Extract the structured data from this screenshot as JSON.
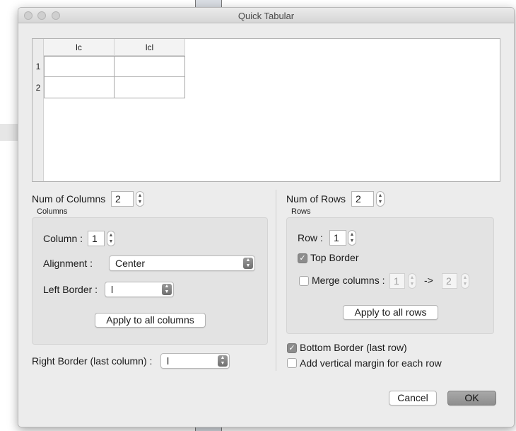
{
  "window": {
    "title": "Quick Tabular"
  },
  "table_editor": {
    "column_headers": [
      "lc",
      "lcl"
    ],
    "row_numbers": [
      "1",
      "2"
    ]
  },
  "columns": {
    "num_label": "Num of Columns",
    "num_value": "2",
    "group_label": "Columns",
    "column_label": "Column :",
    "column_value": "1",
    "alignment_label": "Alignment :",
    "alignment_value": "Center",
    "left_border_label": "Left Border :",
    "left_border_value": "l",
    "apply_button": "Apply to all columns",
    "right_border_label": "Right Border (last column) :",
    "right_border_value": "l"
  },
  "rows": {
    "num_label": "Num of Rows",
    "num_value": "2",
    "group_label": "Rows",
    "row_label": "Row :",
    "row_value": "1",
    "top_border_label": "Top Border",
    "top_border_checked": true,
    "merge_label": "Merge columns :",
    "merge_checked": false,
    "merge_from": "1",
    "merge_arrow": "->",
    "merge_to": "2",
    "apply_button": "Apply to all rows",
    "bottom_border_label": "Bottom Border (last row)",
    "bottom_border_checked": true,
    "vertical_margin_label": "Add vertical margin for each row",
    "vertical_margin_checked": false
  },
  "footer": {
    "cancel": "Cancel",
    "ok": "OK"
  },
  "icons": {
    "stepper": "up-down-stepper-icon",
    "popup": "chevron-updown-icon",
    "check": "checkmark-icon"
  }
}
